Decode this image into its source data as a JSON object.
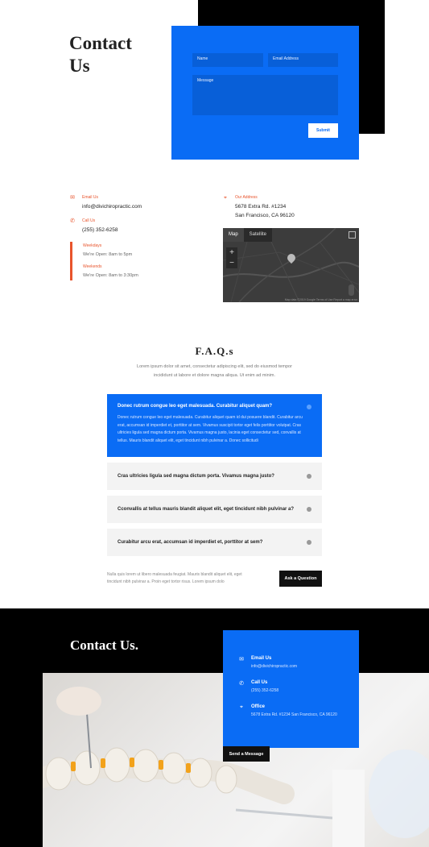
{
  "hero": {
    "title_line1": "Contact",
    "title_line2": "Us"
  },
  "form": {
    "name_placeholder": "Name",
    "email_placeholder": "Email Address",
    "message_placeholder": "Message",
    "submit_label": "Submit"
  },
  "contact_info": {
    "email_label": "Email Us",
    "email_value": "info@divichiropractic.com",
    "call_label": "Call Us",
    "call_value": "(255) 352-6258",
    "address_label": "Our Address",
    "address_line1": "5678 Extra Rd. #1234",
    "address_line2": "San Francisco, CA 96120",
    "weekdays_label": "Weekdays",
    "weekdays_value": "We're Open: 8am to 5pm",
    "weekends_label": "Weekends",
    "weekends_value": "We're Open: 8am to 3:30pm"
  },
  "map": {
    "tab_map": "Map",
    "tab_satellite": "Satellite",
    "zoom_in": "+",
    "zoom_out": "−",
    "credit": "Map data ©2019 Google   Terms of Use   Report a map error"
  },
  "faq": {
    "title": "F.A.Q.s",
    "intro": "Lorem ipsum dolor sit amet, consectetur adipiscing elit, sed do eiusmod tempor incididunt ut labore et dolore magna aliqua. Ut enim ad minim.",
    "open_question": "Donec rutrum congue leo eget malesuada. Curabitur aliquet quam?",
    "open_answer": "Donec rutrum congue leo eget malesuada. Curabitur aliquet quam id dui posuere blandit. Curabitur arcu erat, accumsan id imperdiet et, porttitor at sem. Vivamus suscipit tortor eget felis porttitor volutpat. Cras ultricies ligula sed magna dictum porta. Vivamus magna justo, lacinia eget consectetur sed, convallis at tellus. Mauris blandit aliquet elit, eget tincidunt nibh pulvinar a. Donec sollicitudi",
    "items": [
      {
        "question": "Cras ultricies ligula sed magna dictum porta. Vivamus magna justo?"
      },
      {
        "question": "Cconvallis at tellus mauris blandit aliquet elit, eget tincidunt nibh pulvinar a?"
      },
      {
        "question": "Curabitur arcu erat, accumsan id imperdiet et, porttitor at sem?"
      }
    ],
    "note": "Nulla quis lorem ut libero malesuada feugiat. Mauris blandit aliquet elit, eget tincidunt nibh pulvinar a. Proin eget tortor risus. Lorem ipsum dolo",
    "ask_label": "Ask a Question"
  },
  "footer": {
    "title": "Contact Us.",
    "email_label": "Email Us",
    "email_value": "info@divichiropractic.com",
    "call_label": "Call Us",
    "call_value": "(255) 352-6258",
    "office_label": "Office",
    "office_value": "5678 Extra Rd. #1234 San Francisco, CA 96120",
    "send_label": "Send a Message"
  },
  "colors": {
    "accent_blue": "#0a6cf5",
    "accent_orange": "#e8542c",
    "black": "#000000"
  }
}
